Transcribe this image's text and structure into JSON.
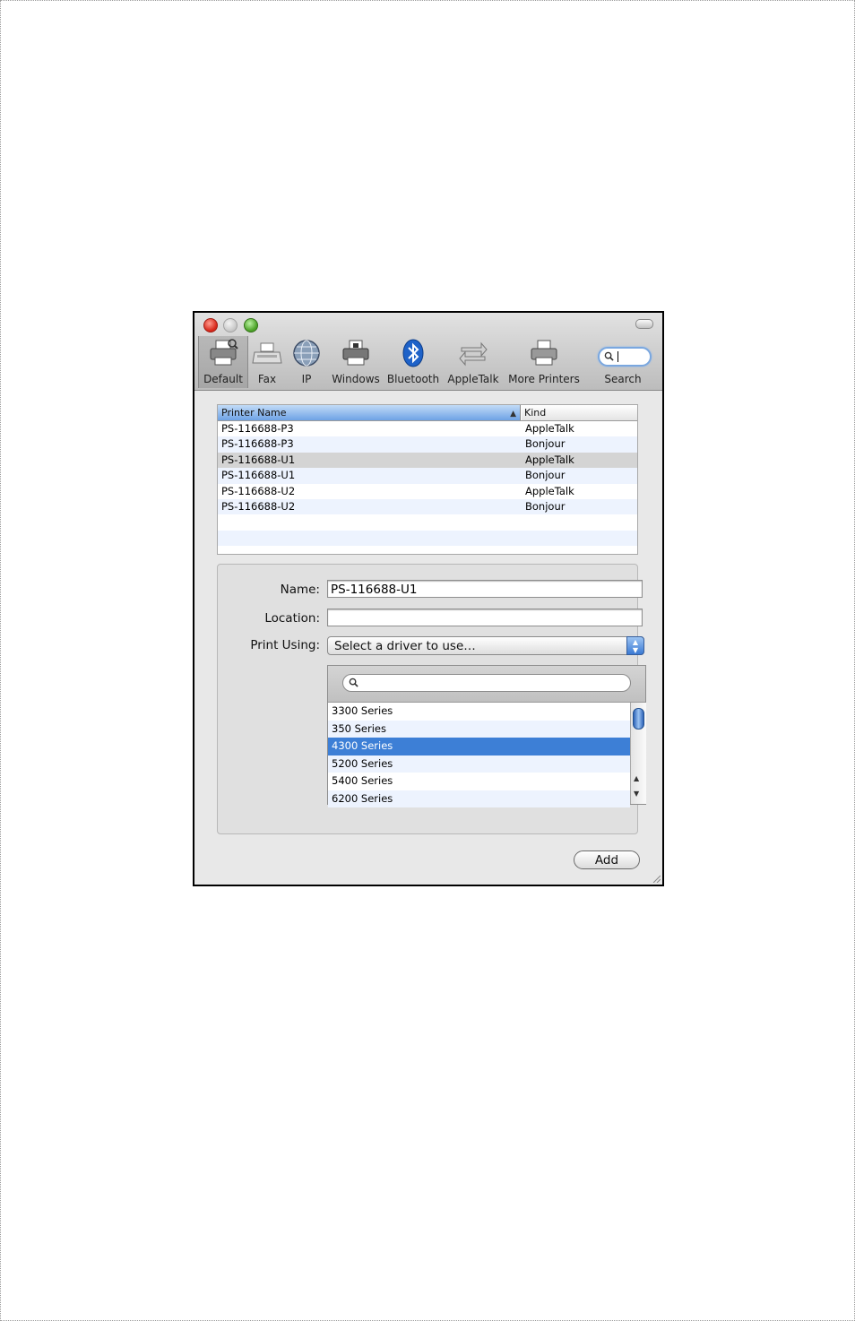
{
  "toolbar": {
    "items": [
      {
        "label": "Default",
        "icon": "printer-icon",
        "active": true
      },
      {
        "label": "Fax",
        "icon": "fax-icon"
      },
      {
        "label": "IP",
        "icon": "globe-icon"
      },
      {
        "label": "Windows",
        "icon": "windows-printer-icon"
      },
      {
        "label": "Bluetooth",
        "icon": "bluetooth-icon"
      },
      {
        "label": "AppleTalk",
        "icon": "appletalk-arrows-icon"
      },
      {
        "label": "More Printers",
        "icon": "more-printers-icon"
      }
    ],
    "search_label": "Search"
  },
  "printer_list": {
    "columns": [
      "Printer Name",
      "Kind"
    ],
    "rows": [
      {
        "name": "PS-116688-P3",
        "kind": "AppleTalk"
      },
      {
        "name": "PS-116688-P3",
        "kind": "Bonjour"
      },
      {
        "name": "PS-116688-U1",
        "kind": "AppleTalk",
        "selected": true
      },
      {
        "name": "PS-116688-U1",
        "kind": "Bonjour"
      },
      {
        "name": "PS-116688-U2",
        "kind": "AppleTalk"
      },
      {
        "name": "PS-116688-U2",
        "kind": "Bonjour"
      }
    ]
  },
  "form": {
    "name_label": "Name:",
    "name_value": "PS-116688-U1",
    "location_label": "Location:",
    "location_value": "",
    "print_using_label": "Print Using:",
    "print_using_value": "Select a driver to use…"
  },
  "drivers": {
    "items": [
      "3300 Series",
      "350 Series",
      "4300 Series",
      "5200 Series",
      "5400 Series",
      "6200 Series"
    ],
    "selected_index": 2
  },
  "add_label": "Add",
  "colors": {
    "selection": "#3d7fd6",
    "header_sort": "#6ea2e5"
  }
}
